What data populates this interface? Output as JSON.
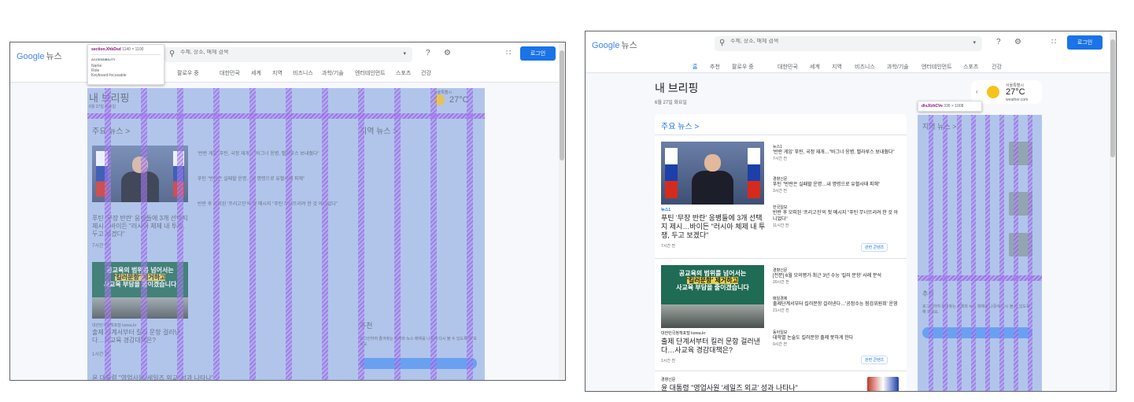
{
  "header": {
    "logo_google": "Google",
    "logo_news": "뉴스",
    "search_placeholder": "주제, 장소, 매체 검색",
    "login_label": "로그인"
  },
  "nav": {
    "items": [
      "홈",
      "추천",
      "팔로우 중",
      "대한민국",
      "세계",
      "지역",
      "비즈니스",
      "과학/기술",
      "엔터테인먼트",
      "스포츠",
      "건강"
    ],
    "left_visible": [
      "팔로우 중",
      "대한민국",
      "세계",
      "지역",
      "비즈니스",
      "과학/기술",
      "엔터테인먼트",
      "스포츠",
      "건강"
    ]
  },
  "briefing": {
    "title": "내 브리핑",
    "date": "6월 27일 화요일"
  },
  "weather": {
    "location": "서울특별시",
    "temp": "27°C",
    "source": "weather.com"
  },
  "top_news": {
    "section_label": "주요 뉴스 >",
    "story1": {
      "source": "뉴스1",
      "title": "푸틴 '무장 반란' 응병들에 3개 선택지 제시…바이든 \"러시아 체제 내 투쟁, 두고 보겠다\"",
      "time": "7시간 전",
      "related": [
        {
          "source": "뉴스1",
          "title": "'반란 게임' 푸틴, 국정 재개…\"바그너 응병, 벨라루스 보내줬다\"",
          "time": "7시간 전"
        },
        {
          "source": "경향신문",
          "title": "푸틴 \"반란은 실패할 운명…내 명령으로 유혈사태 피해\"",
          "time": "3시간 전"
        },
        {
          "source": "한국일보",
          "title": "반란 후 모피된 '프리고진'의 첫 메시지 \"푸틴 무너뜨리려 한 것 아니었다\"",
          "time": "11시간 전"
        }
      ],
      "coverage_label": "관련 콘텐츠"
    },
    "story2": {
      "image_text_line1": "공교육의 범위를 넘어서는",
      "image_text_line2": "'킬러문항' 제거하고",
      "image_text_line3": "사교육 부담을 줄이겠습니다",
      "source": "대한민국정책포털 korea.kr",
      "title": "출제 단계서부터 킬러 문항 걸러낸다…사교육 경감대책은?",
      "time": "1시간 전",
      "related": [
        {
          "source": "경향신문",
          "title": "[전문] 6월 모의평가·최근 3년 수능 '킬러 문항' 사례 분석",
          "time": "20시간 전"
        },
        {
          "source": "매일경제",
          "title": "출제단계서부터 킬러문항 걸러낸다…'공정수능 점검위원회' 운영",
          "time": "21시간 전"
        },
        {
          "source": "동아일보",
          "title": "대학별 논술도 킬러문항 출제 못하게 한다",
          "time": "9시간 전"
        }
      ],
      "coverage_label": "관련 콘텐츠"
    },
    "story3": {
      "source": "경향신문",
      "title": "윤 대통령 \"영업사원 '세일즈 외교' 성과 나타나\""
    }
  },
  "local_news": {
    "section_label": "지역 뉴스 >",
    "recommend_label": "추천",
    "recommend_text": "로그인하여 즐겨찾는 주제와 뉴스 매체를 나중에 다시 볼 수 있도록 해 보세요.",
    "login_label": "로그인"
  },
  "devtools": {
    "left_tip_tag": "section.XhbDsd",
    "left_tip_size": "1140 × 1100",
    "left_tip_heading": "ACCESSIBILITY",
    "left_tip_name": "Name",
    "left_tip_role": "Role",
    "left_tip_kb": "Keyboard-focusable",
    "right_tip_tag": "div.RzhCVe",
    "right_tip_size": "336 × 1008"
  }
}
